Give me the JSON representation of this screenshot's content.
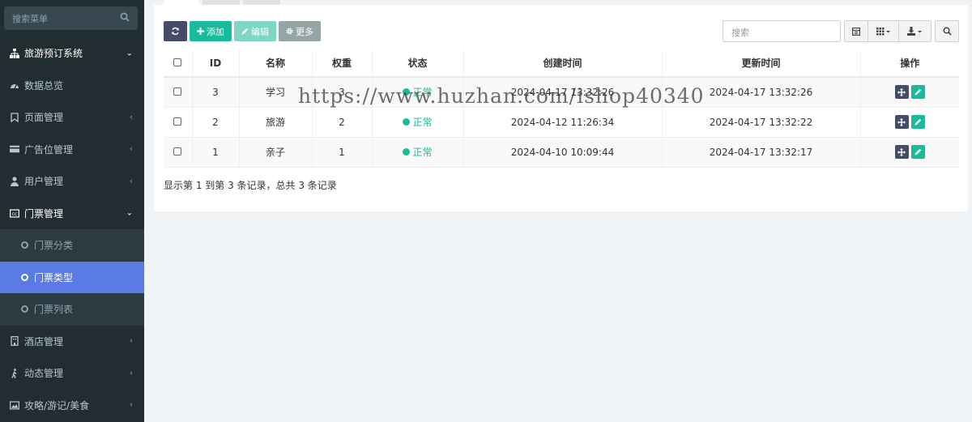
{
  "sidebar": {
    "search_placeholder": "搜索菜单",
    "items": [
      {
        "label": "旅游预订系统",
        "icon": "sitemap-icon",
        "arrow": "⌄"
      },
      {
        "label": "数据总览",
        "icon": "dashboard-icon"
      },
      {
        "label": "页面管理",
        "icon": "bookmark-icon",
        "arrow": "‹"
      },
      {
        "label": "广告位管理",
        "icon": "credit-card-icon",
        "arrow": "‹"
      },
      {
        "label": "用户管理",
        "icon": "user-icon",
        "arrow": "‹"
      },
      {
        "label": "门票管理",
        "icon": "ticket-icon",
        "arrow": "⌄"
      },
      {
        "label": "门票分类",
        "icon": "circle-icon"
      },
      {
        "label": "门票类型",
        "icon": "circle-icon"
      },
      {
        "label": "门票列表",
        "icon": "circle-icon"
      },
      {
        "label": "酒店管理",
        "icon": "building-icon",
        "arrow": "‹"
      },
      {
        "label": "动态管理",
        "icon": "walking-icon",
        "arrow": "‹"
      },
      {
        "label": "攻略/游记/美食",
        "icon": "image-icon",
        "arrow": "‹"
      }
    ]
  },
  "toolbar": {
    "add_label": "添加",
    "edit_label": "编辑",
    "more_label": "更多",
    "search_placeholder": "搜索"
  },
  "table": {
    "headers": [
      "ID",
      "名称",
      "权重",
      "状态",
      "创建时间",
      "更新时间",
      "操作"
    ],
    "rows": [
      {
        "id": "3",
        "name": "学习",
        "weight": "3",
        "status": "正常",
        "created": "2024-04-17 13:32:26",
        "updated": "2024-04-17 13:32:26"
      },
      {
        "id": "2",
        "name": "旅游",
        "weight": "2",
        "status": "正常",
        "created": "2024-04-12 11:26:34",
        "updated": "2024-04-17 13:32:22"
      },
      {
        "id": "1",
        "name": "亲子",
        "weight": "1",
        "status": "正常",
        "created": "2024-04-10 10:09:44",
        "updated": "2024-04-17 13:32:17"
      }
    ]
  },
  "pagination_text": "显示第 1 到第 3 条记录，总共 3 条记录",
  "watermark": "https://www.huzhan.com/ishop40340",
  "colors": {
    "sidebar_bg": "#222d32",
    "active": "#5b7be4",
    "accent": "#18bc9c",
    "dark_btn": "#444c69"
  }
}
